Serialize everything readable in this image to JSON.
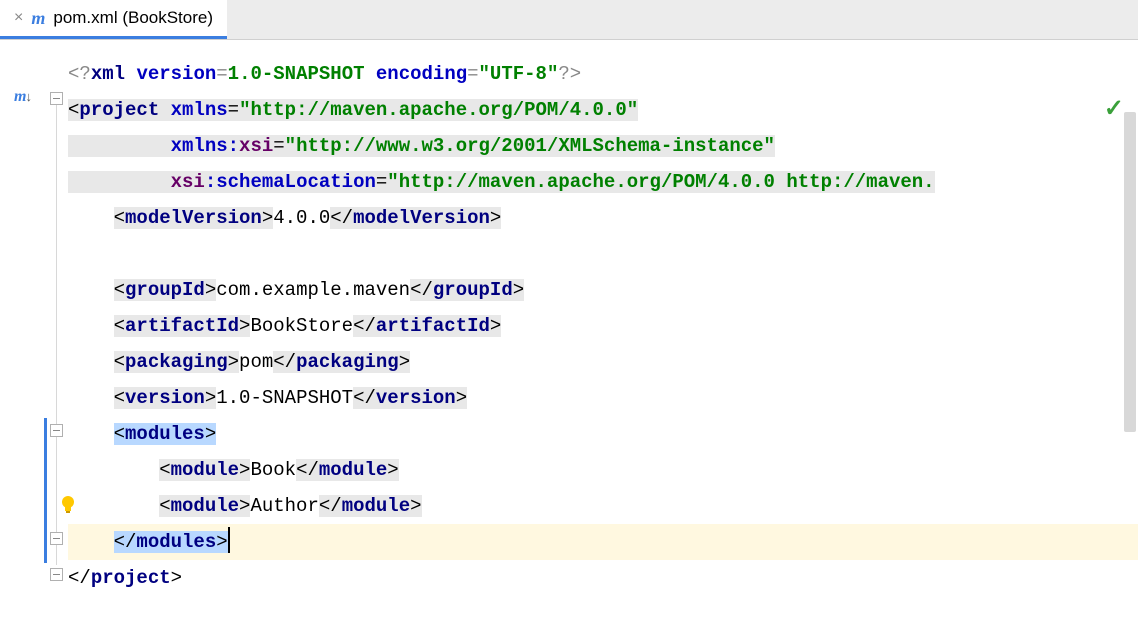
{
  "tab": {
    "filename": "pom.xml (BookStore)"
  },
  "code": {
    "xml_decl_prefix": "<?",
    "xml_decl_name": "xml",
    "version_attr": "version",
    "version_val": "1.0-SNAPSHOT",
    "encoding_attr": "encoding",
    "encoding_val": "\"UTF-8\"",
    "xml_decl_suffix": "?>",
    "project": "project",
    "xmlns": "xmlns",
    "xmlns_val": "\"http://maven.apache.org/POM/4.0.0\"",
    "xmlns_xsi_prefix": "xmlns:",
    "xsi": "xsi",
    "xmlns_xsi_val": "\"http://www.w3.org/2001/XMLSchema-instance\"",
    "xsi_prefix": "xsi",
    "schemaLocation": "schemaLocation",
    "schemaLocation_val": "\"http://maven.apache.org/POM/4.0.0 http://maven.",
    "modelVersion": "modelVersion",
    "modelVersion_val": "4.0.0",
    "groupId": "groupId",
    "groupId_val": "com.example.maven",
    "artifactId": "artifactId",
    "artifactId_val": "BookStore",
    "packaging": "packaging",
    "packaging_val": "pom",
    "version": "version",
    "modules": "modules",
    "module": "module",
    "module1_val": "Book",
    "module2_val": "Author"
  }
}
